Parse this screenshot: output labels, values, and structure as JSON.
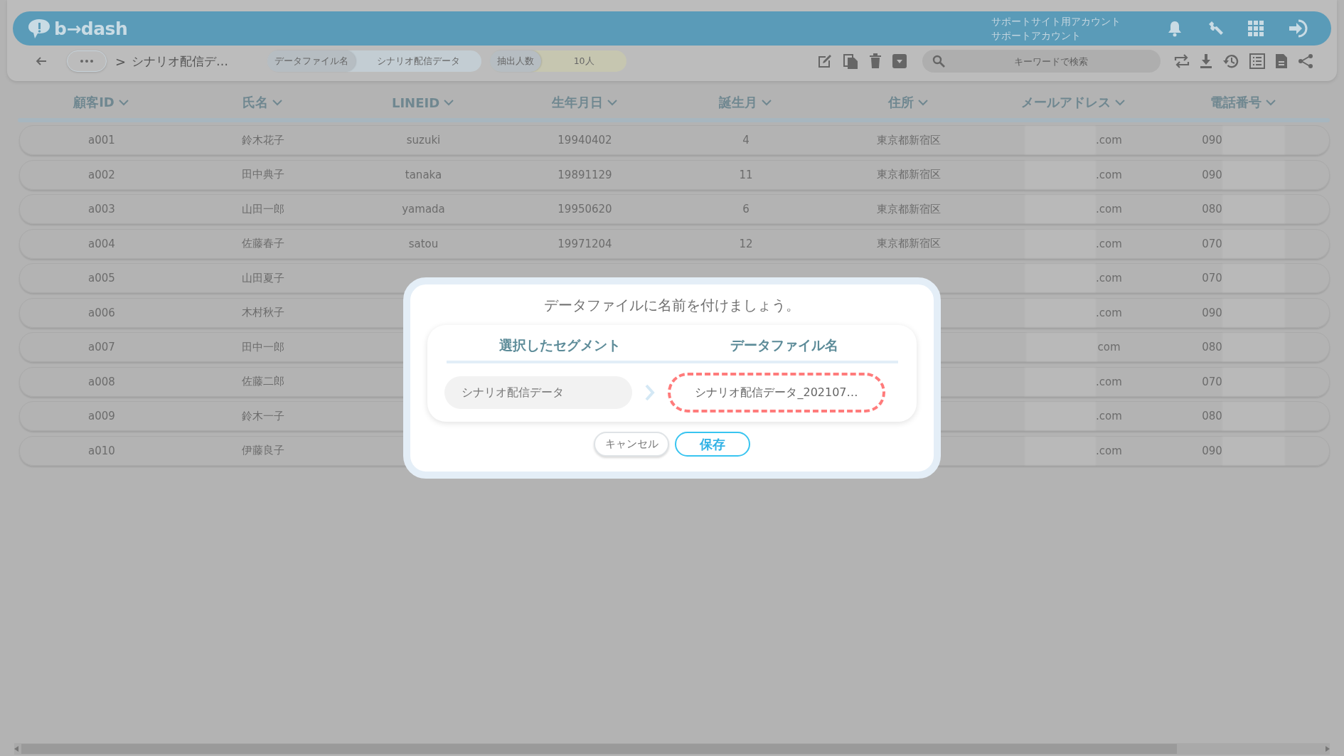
{
  "header": {
    "logo": "b→dash",
    "account_lines": [
      "サポートサイト用アカウント",
      "サポートアカウント"
    ]
  },
  "toolbar": {
    "separator": ">",
    "breadcrumb": "シナリオ配信デ…",
    "pills": [
      {
        "label": "データファイル名",
        "value": "シナリオ配信データ",
        "color": "#c3cdd3"
      },
      {
        "label": "抽出人数",
        "value": "10人",
        "color": "#c6c6b0"
      }
    ],
    "search": {
      "placeholder": "キーワードで検索"
    }
  },
  "table": {
    "columns": [
      "顧客ID",
      "氏名",
      "LINEID",
      "生年月日",
      "誕生月",
      "住所",
      "メールアドレス",
      "電話番号"
    ],
    "rows": [
      {
        "cells": [
          "a001",
          "鈴木花子",
          "suzuki",
          "19940402",
          "4",
          "東京都新宿区",
          ".com",
          "090"
        ]
      },
      {
        "cells": [
          "a002",
          "田中典子",
          "tanaka",
          "19891129",
          "11",
          "東京都新宿区",
          ".com",
          "090"
        ]
      },
      {
        "cells": [
          "a003",
          "山田一郎",
          "yamada",
          "19950620",
          "6",
          "東京都新宿区",
          ".com",
          "080"
        ]
      },
      {
        "cells": [
          "a004",
          "佐藤春子",
          "satou",
          "19971204",
          "12",
          "東京都新宿区",
          ".com",
          "070"
        ]
      },
      {
        "cells": [
          "a005",
          "山田夏子",
          null,
          null,
          null,
          null,
          ".com",
          "070"
        ]
      },
      {
        "cells": [
          "a006",
          "木村秋子",
          null,
          null,
          null,
          null,
          ".com",
          "090"
        ]
      },
      {
        "cells": [
          "a007",
          "田中一郎",
          null,
          null,
          null,
          null,
          "com",
          "080"
        ]
      },
      {
        "cells": [
          "a008",
          "佐藤二郎",
          null,
          null,
          null,
          null,
          ".com",
          "070"
        ]
      },
      {
        "cells": [
          "a009",
          "鈴木一子",
          null,
          null,
          null,
          null,
          ".com",
          "080"
        ]
      },
      {
        "cells": [
          "a010",
          "伊藤良子",
          null,
          null,
          null,
          null,
          ".com",
          "090"
        ]
      }
    ]
  },
  "dialog": {
    "title": "データファイルに名前を付けましょう。",
    "segment_heading": "選択したセグメント",
    "filename_heading": "データファイル名",
    "segment_value": "シナリオ配信データ",
    "filename_value": "シナリオ配信データ_202107…",
    "buttons": [
      {
        "label": "キャンセル",
        "kind": "cancel"
      },
      {
        "label": "保存",
        "kind": "primary"
      }
    ]
  }
}
